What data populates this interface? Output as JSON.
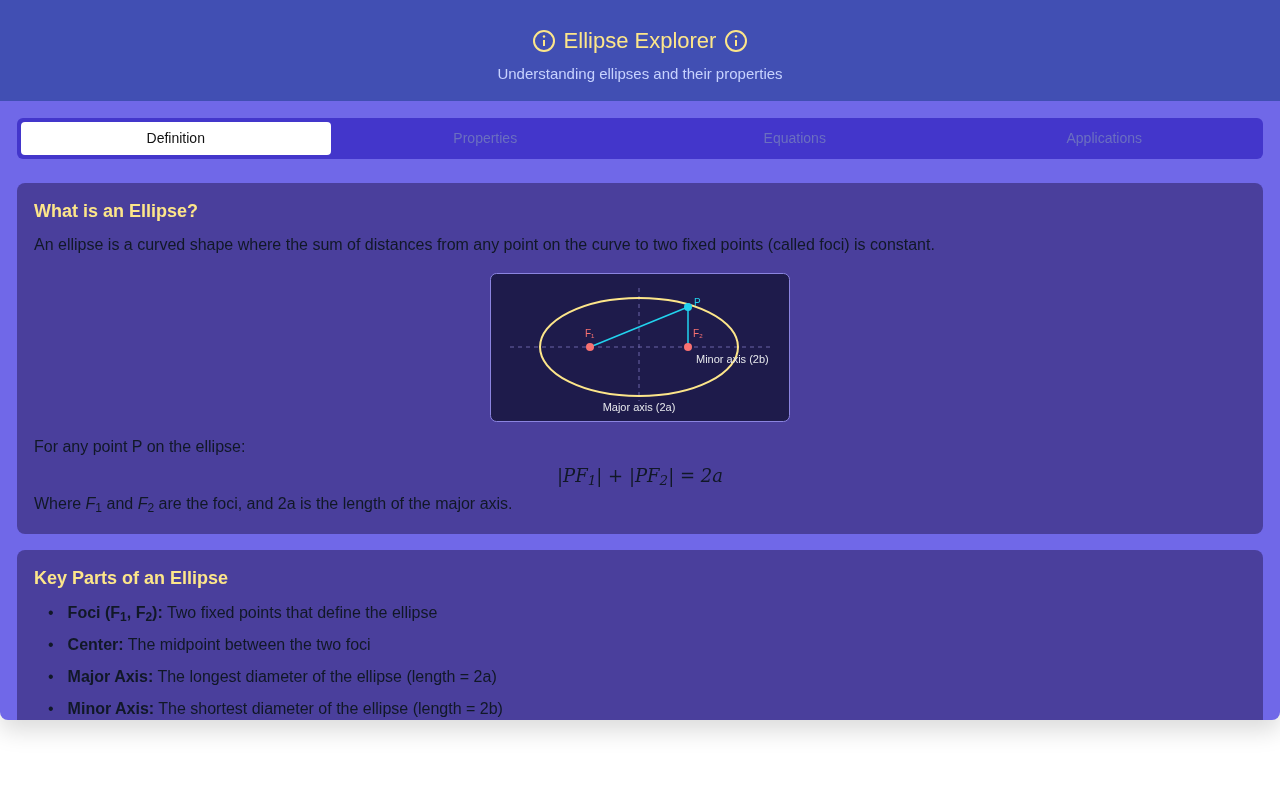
{
  "header": {
    "title": "Ellipse Explorer",
    "subtitle": "Understanding ellipses and their properties"
  },
  "tabs": [
    {
      "label": "Definition",
      "selected": true
    },
    {
      "label": "Properties",
      "selected": false
    },
    {
      "label": "Equations",
      "selected": false
    },
    {
      "label": "Applications",
      "selected": false
    }
  ],
  "definition_card": {
    "title": "What is an Ellipse?",
    "intro": "An ellipse is a curved shape where the sum of distances from any point on the curve to two fixed points (called foci) is constant.",
    "diagram": {
      "focus_1": "F₁",
      "focus_2": "F₂",
      "point": "P",
      "minor_axis_label": "Minor axis (2b)",
      "major_axis_label": "Major axis (2a)"
    },
    "lead": "For any point P on the ellipse:",
    "formula": "|PF$_{1}$| + |PF$_{2}$| = 2a",
    "note": "Where *F*$_{1}$ and *F*$_{2}$ are the foci, and 2a is the length of the major axis."
  },
  "parts_card": {
    "title": "Key Parts of an Ellipse",
    "items": [
      {
        "marker": "•",
        "text": "**Foci (F$_{1}$, F$_{2}$):** Two fixed points that define the ellipse"
      },
      {
        "marker": "•",
        "text": "**Center:** The midpoint between the two foci"
      },
      {
        "marker": "•",
        "text": "**Major Axis:** The longest diameter of the ellipse (length = 2a)"
      },
      {
        "marker": "•",
        "text": "**Minor Axis:** The shortest diameter of the ellipse (length = 2b)"
      }
    ]
  }
}
